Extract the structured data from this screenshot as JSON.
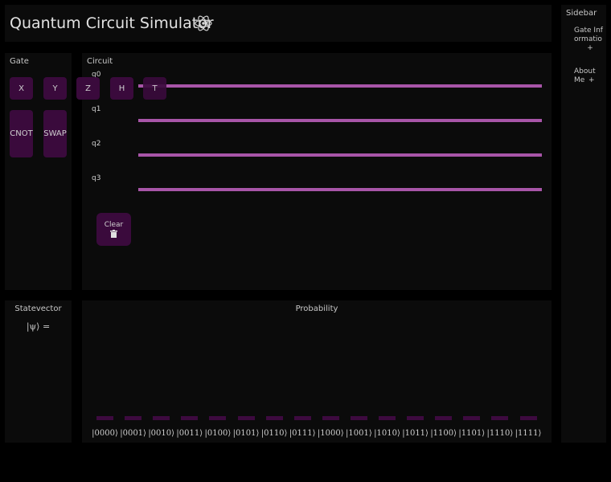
{
  "header": {
    "title": "Quantum Circuit Simulator"
  },
  "gate_panel": {
    "title": "Gate",
    "gates": [
      "X",
      "Y",
      "Z",
      "H",
      "T"
    ],
    "multi_gates": [
      "CNOT",
      "SWAP"
    ]
  },
  "circuit_panel": {
    "title": "Circuit",
    "qubits": [
      "q0",
      "q1",
      "q2",
      "q3"
    ],
    "clear_label": "Clear"
  },
  "statevector_panel": {
    "title": "Statevector",
    "expression": "|ψ⟩ ="
  },
  "probability_panel": {
    "title": "Probability",
    "states": [
      "|0000⟩",
      "|0001⟩",
      "|0010⟩",
      "|0011⟩",
      "|0100⟩",
      "|0101⟩",
      "|0110⟩",
      "|0111⟩",
      "|1000⟩",
      "|1001⟩",
      "|1010⟩",
      "|1011⟩",
      "|1100⟩",
      "|1101⟩",
      "|1110⟩",
      "|1111⟩"
    ]
  },
  "sidebar": {
    "title": "Sidebar",
    "items": [
      {
        "label": "Gate Informatio",
        "toggle": "+"
      },
      {
        "label": "About Me",
        "toggle": "+"
      }
    ]
  },
  "colors": {
    "background": "#000000",
    "panel": "#0b0b0b",
    "gate": "#3a0a3c",
    "wire": "#a855a8"
  },
  "icons": {
    "header": "atom-icon",
    "clear": "trash-icon"
  }
}
